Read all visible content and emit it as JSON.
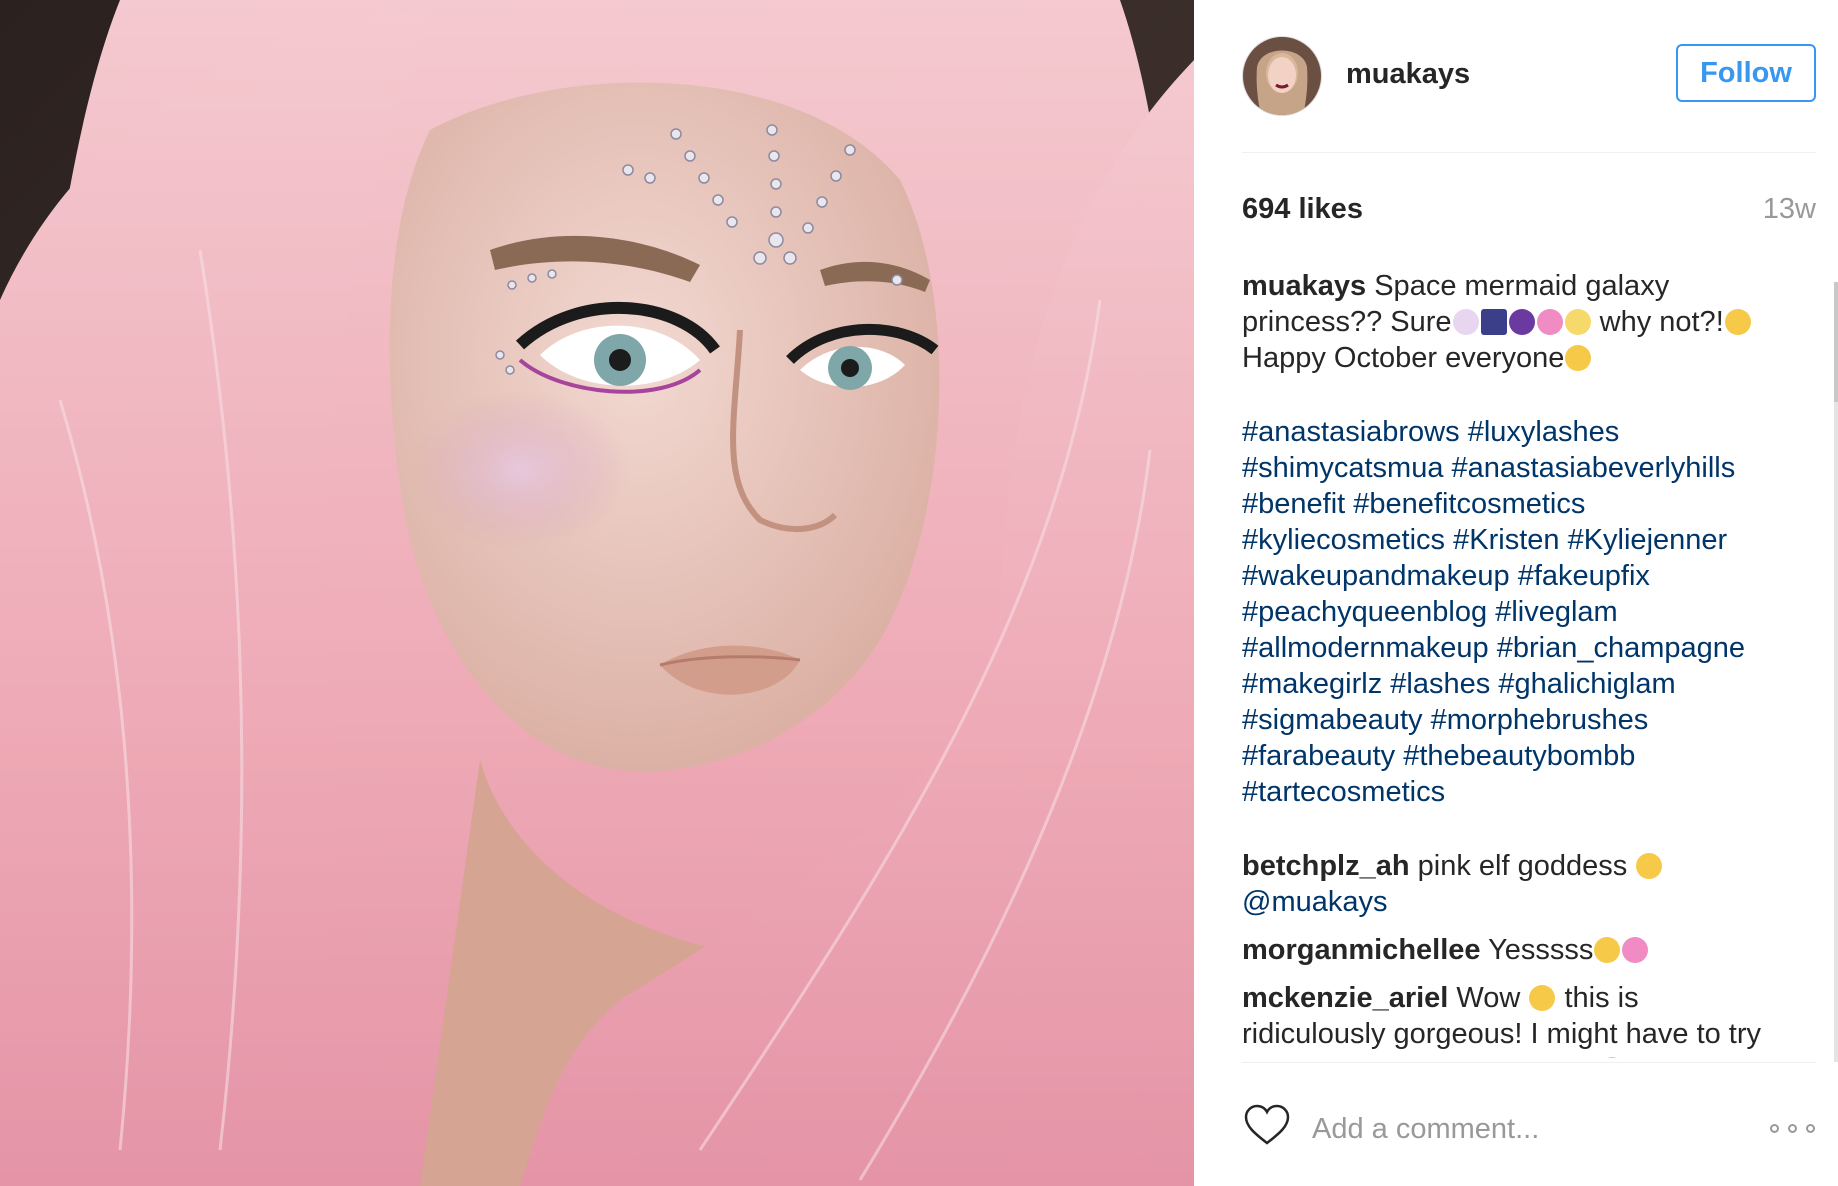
{
  "post": {
    "username": "muakays",
    "follow_label": "Follow",
    "likes": "694 likes",
    "age": "13w"
  },
  "caption": {
    "user": "muakays",
    "text_1": "Space mermaid galaxy princess?? Sure",
    "text_2": " why not?!",
    "text_3": "Happy October everyone",
    "hashtags": [
      "#anastasiabrows",
      "#luxylashes",
      "#shimycatsmua",
      "#anastasiabeverlyhills",
      "#benefit",
      "#benefitcosmetics",
      "#kyliecosmetics",
      "#Kristen",
      "#Kyliejenner",
      "#wakeupandmakeup",
      "#fakeupfix",
      "#peachyqueenblog",
      "#liveglam",
      "#allmodernmakeup",
      "#brian_champagne",
      "#makegirlz",
      "#lashes",
      "#ghalichiglam",
      "#sigmabeauty",
      "#morphebrushes",
      "#farabeauty",
      "#thebeautybombb",
      "#tartecosmetics"
    ]
  },
  "comments": [
    {
      "user": "betchplz_ah",
      "text": "pink elf goddess",
      "mention": "@muakays"
    },
    {
      "user": "morganmichellee",
      "text": "Yesssss"
    },
    {
      "user": "mckenzie_ariel",
      "text_1": "Wow",
      "text_2": "this is ridiculously gorgeous! I might have to try and recreate for Halloween"
    }
  ],
  "add_comment": {
    "placeholder": "Add a comment..."
  },
  "icons": {
    "like": "heart-icon",
    "more": "more-options-icon"
  },
  "colors": {
    "accent": "#3897f0",
    "hashtag": "#003569",
    "muted": "#999999"
  }
}
